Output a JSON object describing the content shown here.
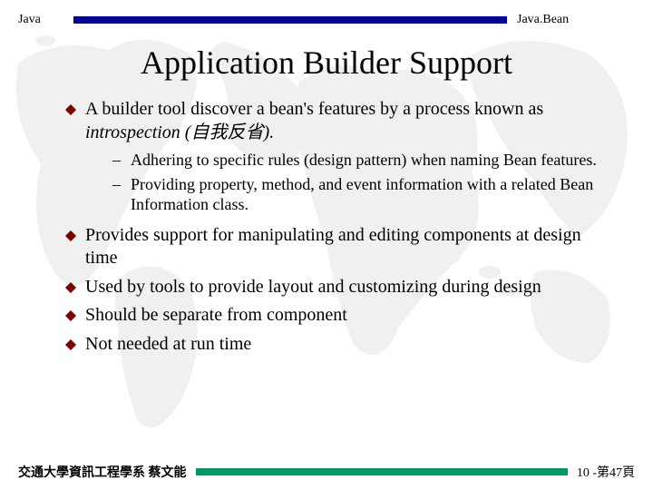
{
  "header": {
    "left": "Java",
    "right": "Java.Bean"
  },
  "title": "Application Builder Support",
  "bullets": [
    {
      "pre": "A builder tool discover a bean's features by a process known as ",
      "em": "introspection (自我反省).",
      "sub": [
        "Adhering to specific rules (design pattern) when naming Bean features.",
        "Providing property, method, and event information with a related Bean Information class."
      ]
    },
    {
      "text": "Provides support for manipulating and editing components at design time"
    },
    {
      "text": "Used by tools to provide layout and customizing during design"
    },
    {
      "text": "Should be separate from component"
    },
    {
      "text": "Not needed at run time"
    }
  ],
  "footer": {
    "left": "交通大學資訊工程學系 蔡文能",
    "right": "10 -第47頁"
  }
}
